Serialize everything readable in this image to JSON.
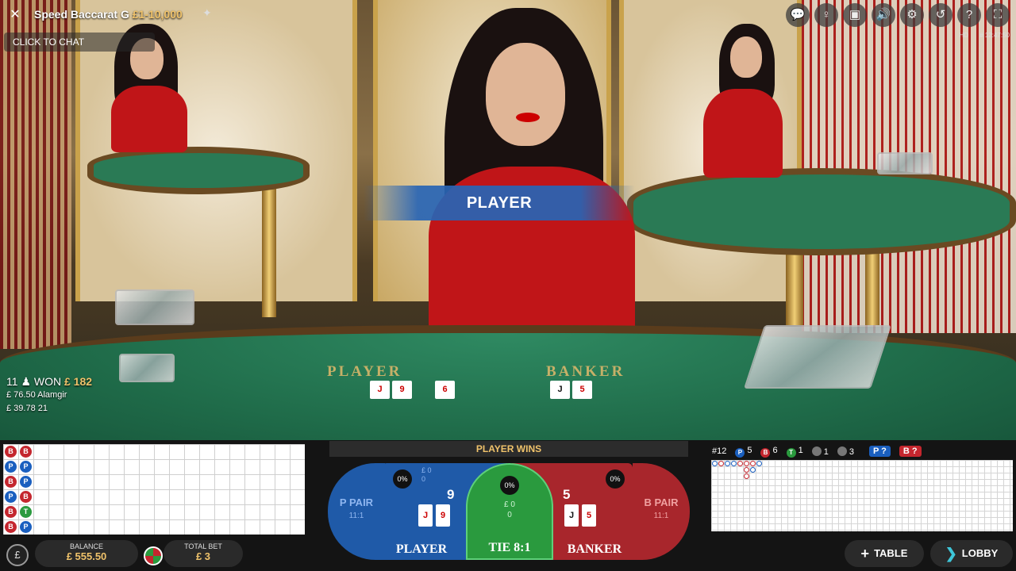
{
  "header": {
    "title": "Speed Baccarat G",
    "limits": "£1-10,000",
    "chat_placeholder": "CLICK TO CHAT",
    "quality": "HD",
    "time": "# 12:47:50",
    "icons": [
      "chat-icon",
      "dealer-icon",
      "video-icon",
      "sound-icon",
      "settings-icon",
      "history-icon",
      "help-icon",
      "fullscreen-icon"
    ]
  },
  "table": {
    "banner": "PLAYER",
    "player_word": "PLAYER",
    "banker_word": "BANKER",
    "player_cards": [
      "J",
      "9",
      "6"
    ],
    "banker_cards": [
      "J",
      "5"
    ]
  },
  "winners": {
    "count": "11",
    "won_label": "WON",
    "won_amount": "£ 182",
    "rows": [
      "£ 76.50 Alamgir",
      "£ 39.78 21"
    ]
  },
  "bead_road": [
    [
      "B",
      "B"
    ],
    [
      "P",
      "P"
    ],
    [
      "B",
      "P"
    ],
    [
      "P",
      "B"
    ],
    [
      "B",
      "T"
    ],
    [
      "B",
      "P"
    ]
  ],
  "betting": {
    "status": "PLAYER WINS",
    "p_pair": {
      "label": "P PAIR",
      "odds": "11:1"
    },
    "b_pair": {
      "label": "B PAIR",
      "odds": "11:1"
    },
    "player": {
      "label": "PLAYER",
      "score": "9",
      "pct": "0%",
      "stake": "£ 0",
      "players": "0",
      "cards": [
        "J",
        "9"
      ]
    },
    "tie": {
      "label": "TIE 8:1",
      "pct": "0%",
      "stake": "£ 0",
      "players": "0"
    },
    "banker": {
      "label": "BANKER",
      "score": "5",
      "pct": "0%",
      "cards": [
        "J",
        "5"
      ]
    }
  },
  "account": {
    "balance_label": "BALANCE",
    "balance": "£ 555.50",
    "total_bet_label": "TOTAL BET",
    "total_bet": "£ 3",
    "currency_symbol": "£"
  },
  "scoreboard": {
    "round": "#12",
    "player_count": "5",
    "banker_count": "6",
    "tie_count": "1",
    "p_pair_count": "1",
    "b_pair_count": "3",
    "player_ask": "P ?",
    "banker_ask": "B ?"
  },
  "nav": {
    "table_label": "TABLE",
    "lobby_label": "LOBBY"
  },
  "colors": {
    "player": "#1f5aa8",
    "banker": "#a8262c",
    "tie": "#2a9a3e",
    "gold": "#f0c36b"
  }
}
